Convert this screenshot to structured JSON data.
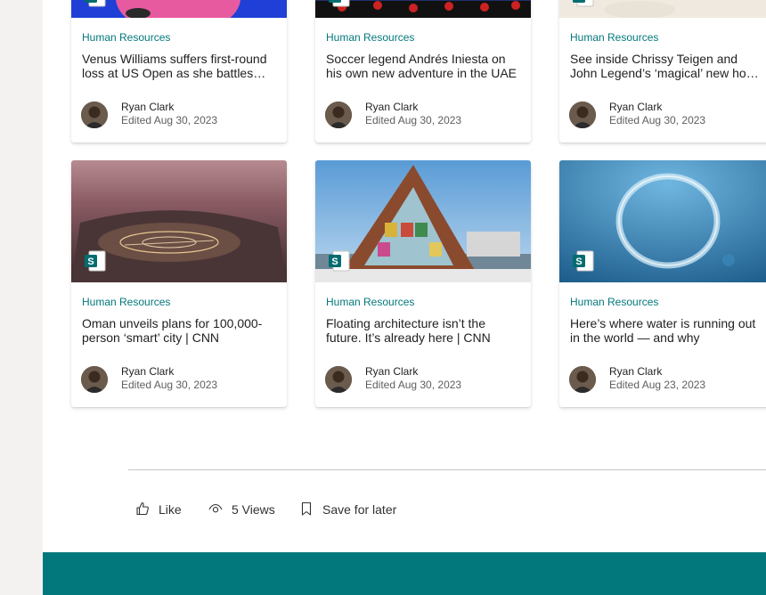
{
  "cards": [
    {
      "category": "Human Resources",
      "title": "Venus Williams suffers first-round loss at US Open as she battles through illness to progress",
      "author": "Ryan Clark",
      "edited": "Edited Aug 30, 2023",
      "thumb": "tennis"
    },
    {
      "category": "Human Resources",
      "title": "Soccer legend Andrés Iniesta on his own new adventure in the UAE",
      "author": "Ryan Clark",
      "edited": "Edited Aug 30, 2023",
      "thumb": "soccer"
    },
    {
      "category": "Human Resources",
      "title": "See inside Chrissy Teigen and John Legend’s ‘magical’ new home | CNN",
      "author": "Ryan Clark",
      "edited": "Edited Aug 30, 2023",
      "thumb": "home"
    },
    {
      "category": "Human Resources",
      "title": "Oman unveils plans for 100,000-person ‘smart’ city | CNN",
      "author": "Ryan Clark",
      "edited": "Edited Aug 30, 2023",
      "thumb": "city"
    },
    {
      "category": "Human Resources",
      "title": "Floating architecture isn’t the future. It’s already here | CNN",
      "author": "Ryan Clark",
      "edited": "Edited Aug 30, 2023",
      "thumb": "architecture"
    },
    {
      "category": "Human Resources",
      "title": "Here’s where water is running out in the world — and why",
      "author": "Ryan Clark",
      "edited": "Edited Aug 23, 2023",
      "thumb": "water"
    }
  ],
  "actions": {
    "like_label": "Like",
    "views_label": "5 Views",
    "save_label": "Save for later"
  },
  "colors": {
    "accent": "#03787c",
    "footer": "#03787c",
    "sharepoint_icon": "#036c70"
  },
  "icons": {
    "like": "thumbs-up-icon",
    "views": "eye-icon",
    "save": "bookmark-icon",
    "page": "sharepoint-page-icon"
  }
}
